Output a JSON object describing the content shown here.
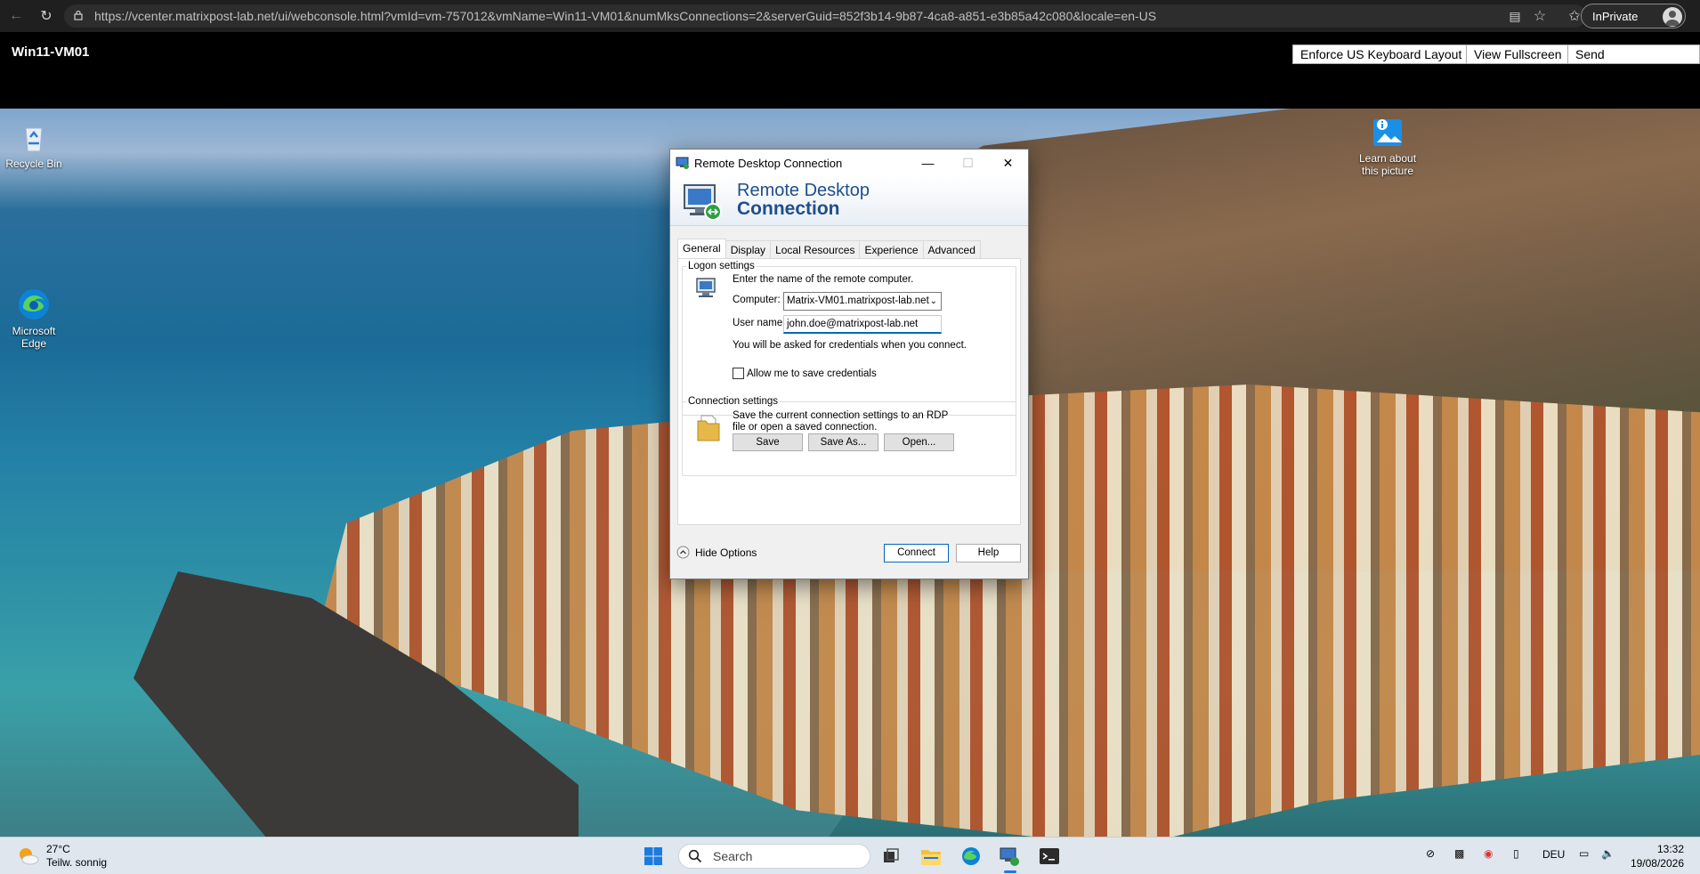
{
  "browser": {
    "url": "https://vcenter.matrixpost-lab.net/ui/webconsole.html?vmId=vm-757012&vmName=Win11-VM01&numMksConnections=2&serverGuid=852f3b14-9b87-4ca8-a851-e3b85a42c080&locale=en-US",
    "inprivate_label": "InPrivate"
  },
  "console": {
    "vm_name": "Win11-VM01",
    "buttons": [
      "Enforce US Keyboard Layout",
      "View Fullscreen",
      "Send Ctrl+Alt+Delete"
    ]
  },
  "desktop": {
    "icons": {
      "recycle_bin": "Recycle Bin",
      "edge": "Microsoft Edge",
      "learn": "Learn about this picture"
    }
  },
  "rdc": {
    "title": "Remote Desktop Connection",
    "banner_line1": "Remote Desktop",
    "banner_line2": "Connection",
    "tabs": [
      "General",
      "Display",
      "Local Resources",
      "Experience",
      "Advanced"
    ],
    "logon": {
      "legend": "Logon settings",
      "instruction": "Enter the name of the remote computer.",
      "computer_label": "Computer:",
      "computer_value": "Matrix-VM01.matrixpost-lab.net",
      "username_label": "User name:",
      "username_value": "john.doe@matrixpost-lab.net",
      "credentials_note": "You will be asked for credentials when you connect.",
      "save_credentials_label": "Allow me to save credentials",
      "save_credentials_checked": false
    },
    "connection": {
      "legend": "Connection settings",
      "description": "Save the current connection settings to an RDP file or open a saved connection.",
      "save_label": "Save",
      "save_as_label": "Save As...",
      "open_label": "Open..."
    },
    "hide_options_label": "Hide Options",
    "connect_label": "Connect",
    "help_label": "Help"
  },
  "taskbar": {
    "weather_temp": "27°C",
    "weather_desc": "Teilw. sonnig",
    "search_placeholder": "Search",
    "language": "DEU",
    "time": "13:32",
    "date": "19/08/2026"
  }
}
